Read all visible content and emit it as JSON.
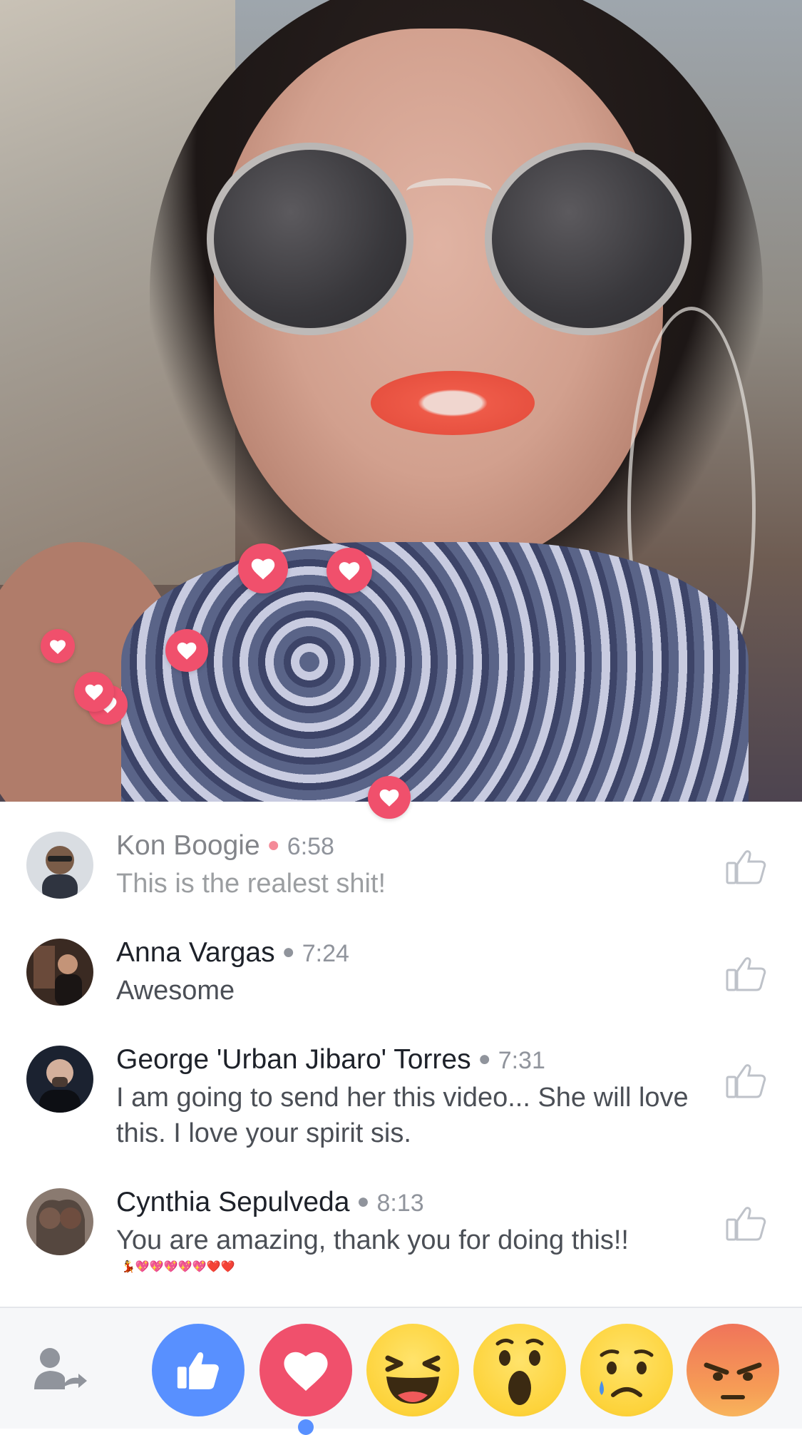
{
  "comments": [
    {
      "name": "Kon Boogie",
      "time": "6:58",
      "text": "This is the realest shit!",
      "liked": false
    },
    {
      "name": "Anna Vargas",
      "time": "7:24",
      "text": "Awesome",
      "liked": false
    },
    {
      "name": "George 'Urban Jibaro' Torres",
      "time": "7:31",
      "text": "I am going to send her this video... She will love this. I love your spirit sis.",
      "liked": false
    },
    {
      "name": "Cynthia Sepulveda",
      "time": "8:13",
      "text": "You are amazing, thank you for doing this!!",
      "emojis": "💃💖💖💖💖💖❤️❤️",
      "liked": false
    }
  ],
  "reactions": [
    "like",
    "love",
    "haha",
    "wow",
    "sad",
    "angry"
  ],
  "selected_reaction": "love",
  "colors": {
    "accent_blue": "#5890ff",
    "love_red": "#f0506c",
    "text_dark": "#1d2129",
    "meta_gray": "#90949c"
  },
  "icons": {
    "share": "share-person-icon",
    "like": "thumbs-up-icon"
  }
}
